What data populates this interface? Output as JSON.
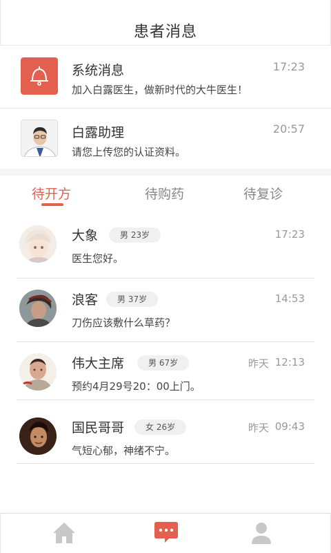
{
  "header": {
    "title": "患者消息"
  },
  "notices": [
    {
      "name": "系统消息",
      "message": "加入白露医生，做新时代的大牛医生！",
      "time": "17:23",
      "icon": "bell-icon"
    },
    {
      "name": "白露助理",
      "message": "请您上传您的认证资料。",
      "time": "20:57",
      "icon": "assistant-avatar"
    }
  ],
  "tabs": [
    {
      "label": "待开方",
      "active": true
    },
    {
      "label": "待购药",
      "active": false
    },
    {
      "label": "待复诊",
      "active": false
    }
  ],
  "patients": [
    {
      "name": "大象",
      "badge": "男 23岁",
      "message": "医生您好。",
      "day": "",
      "time": "17:23"
    },
    {
      "name": "浪客",
      "badge": "男 37岁",
      "message": "刀伤应该敷什么草药？",
      "day": "",
      "time": "14:53"
    },
    {
      "name": "伟大主席",
      "badge": "男 67岁",
      "message": "预约4月29号20：00上门。",
      "day": "昨天",
      "time": "12:13"
    },
    {
      "name": "国民哥哥",
      "badge": "女 26岁",
      "message": "气短心郁，神绪不宁。",
      "day": "昨天",
      "time": "09:43"
    }
  ],
  "bottom_nav": [
    {
      "icon": "home-icon",
      "active": false
    },
    {
      "icon": "message-icon",
      "active": true
    },
    {
      "icon": "profile-icon",
      "active": false
    }
  ],
  "colors": {
    "accent": "#e3604f",
    "inactive_icon": "#c8c8c8",
    "secondary_text": "#999999"
  }
}
